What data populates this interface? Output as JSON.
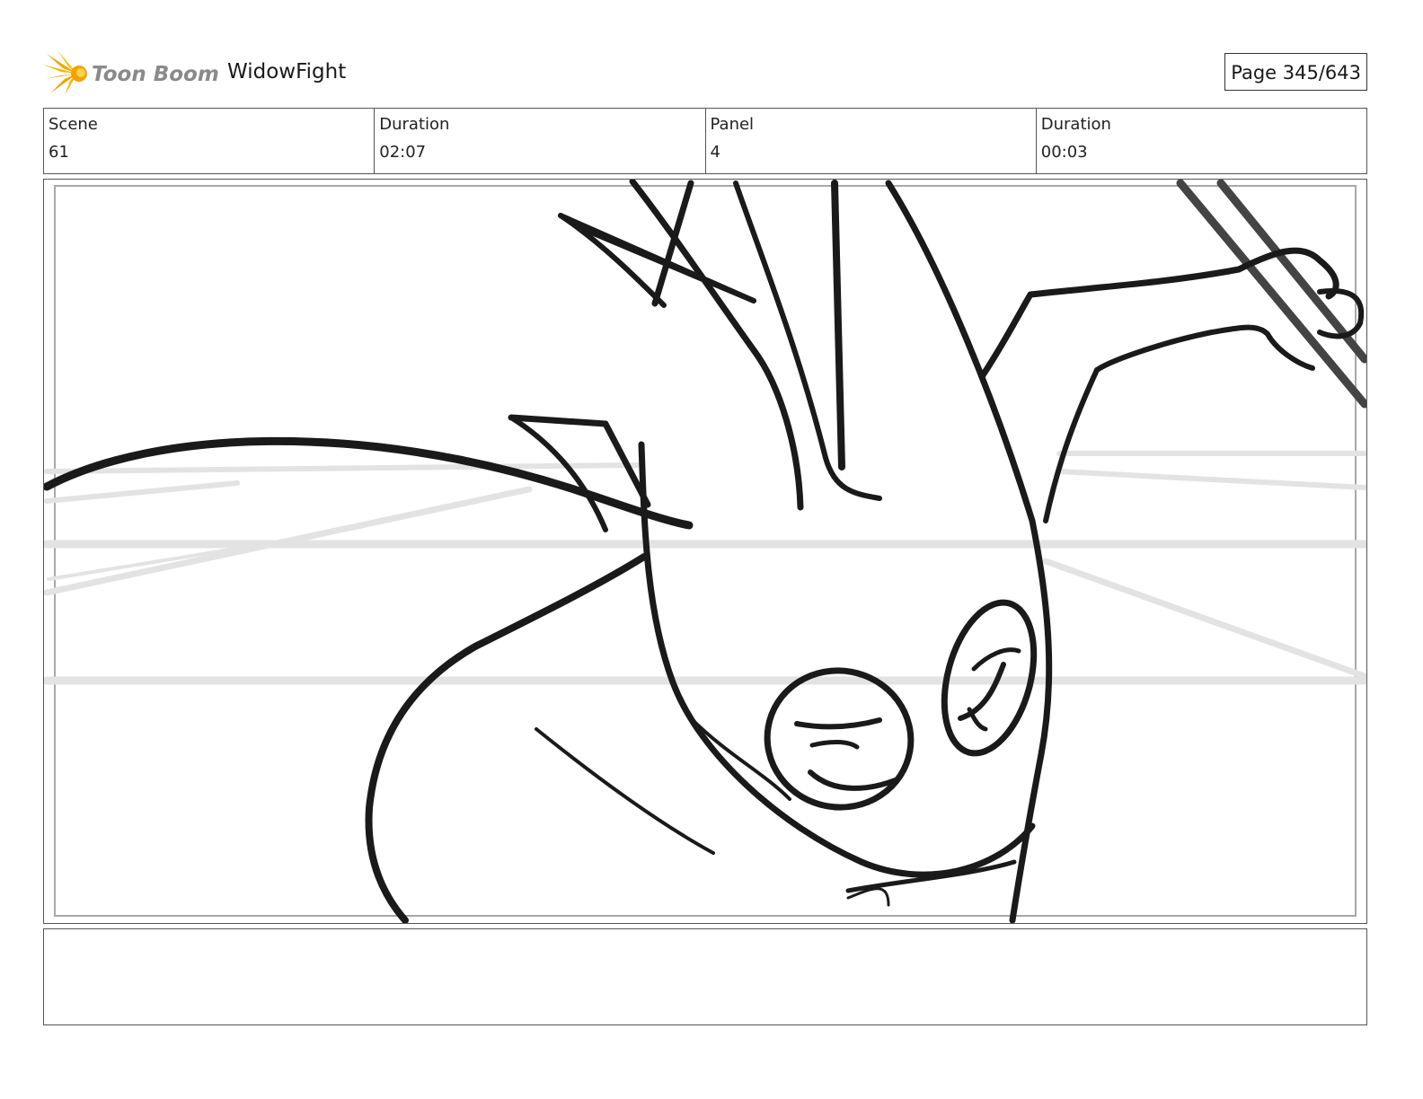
{
  "header": {
    "logo_text": "Toon Boom",
    "project_title": "WidowFight",
    "page_number": "Page 345/643"
  },
  "info": {
    "scene_label": "Scene",
    "scene_value": "61",
    "scene_duration_label": "Duration",
    "scene_duration_value": "02:07",
    "panel_label": "Panel",
    "panel_value": "4",
    "panel_duration_label": "Duration",
    "panel_duration_value": "00:03"
  },
  "colors": {
    "logo_orange": "#f5a100",
    "logo_text_gray": "#8a8a8a",
    "sketch_line": "#1a1a1a",
    "background_line": "#e3e3e3"
  }
}
